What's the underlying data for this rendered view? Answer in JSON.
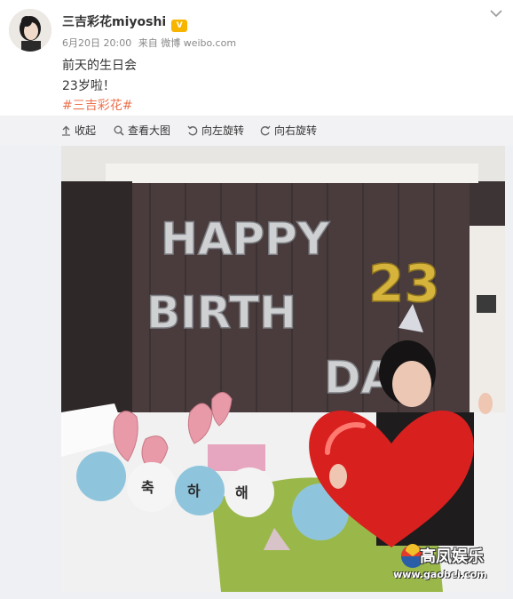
{
  "post": {
    "author_name": "三吉彩花miyoshi",
    "vip_badge": "V",
    "timestamp": "6月20日 20:00",
    "source_prefix": "来自",
    "source": "微博 weibo.com",
    "lines": [
      "前天的生日会",
      "23岁啦！"
    ],
    "hashtag": "#三吉彩花#"
  },
  "toolbar": {
    "collapse": "收起",
    "view_large": "查看大图",
    "rotate_left": "向左旋转",
    "rotate_right": "向右旋转"
  },
  "photo": {
    "balloon_letters": [
      "HAPPY",
      "BIRTH",
      "DAY"
    ],
    "number_balloon": "23",
    "watermark_title": "高凤娱乐",
    "watermark_url": "www.gaobei.com"
  },
  "colors": {
    "accent": "#eb7350",
    "toolbar_bg": "#f2f2f5",
    "page_bg": "#eef0f3"
  }
}
